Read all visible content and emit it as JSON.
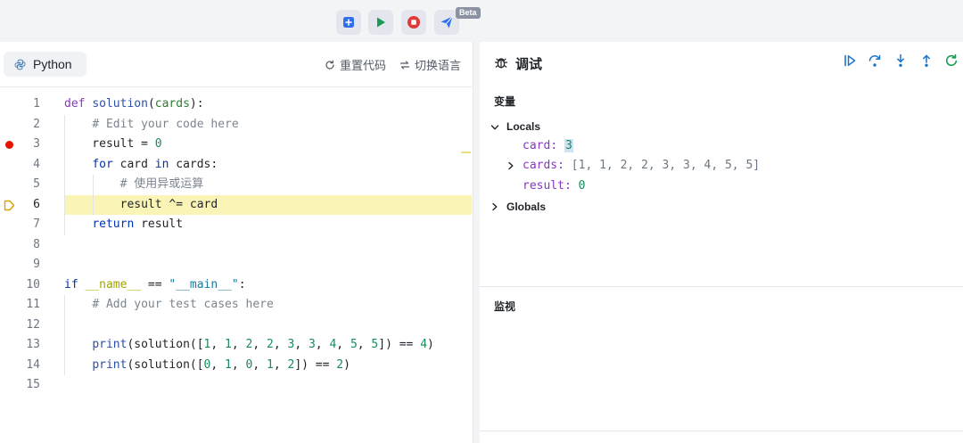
{
  "toolbar": {
    "buttons": [
      {
        "name": "add",
        "icon": "plus-square-icon",
        "color": "#2f6fed"
      },
      {
        "name": "run",
        "icon": "play-icon",
        "color": "#1a9b55"
      },
      {
        "name": "stop",
        "icon": "stop-icon",
        "color": "#e03a3a"
      },
      {
        "name": "send",
        "icon": "send-icon",
        "color": "#2f6fed"
      }
    ],
    "badge": "Beta"
  },
  "editor": {
    "language": "Python",
    "reset_label": "重置代码",
    "switch_label": "切换语言",
    "breakpoint_line": 3,
    "current_line": 6,
    "line_numbers": [
      "1",
      "2",
      "3",
      "4",
      "5",
      "6",
      "7",
      "8",
      "9",
      "10",
      "11",
      "12",
      "13",
      "14",
      "15"
    ]
  },
  "debug": {
    "title": "调试",
    "variables_label": "变量",
    "locals_label": "Locals",
    "globals_label": "Globals",
    "watch_label": "监视",
    "locals": [
      {
        "name": "card",
        "value": "3"
      },
      {
        "name": "cards",
        "value": "[1, 1, 2, 2, 3, 3, 4, 5, 5]"
      },
      {
        "name": "result",
        "value": "0"
      }
    ],
    "controls": [
      "continue-icon",
      "step-over-icon",
      "step-into-icon",
      "step-out-icon",
      "restart-icon"
    ],
    "accent": "#1a73c8"
  },
  "colors": {
    "highlight": "#faf5b6",
    "breakpoint": "#e51400"
  }
}
